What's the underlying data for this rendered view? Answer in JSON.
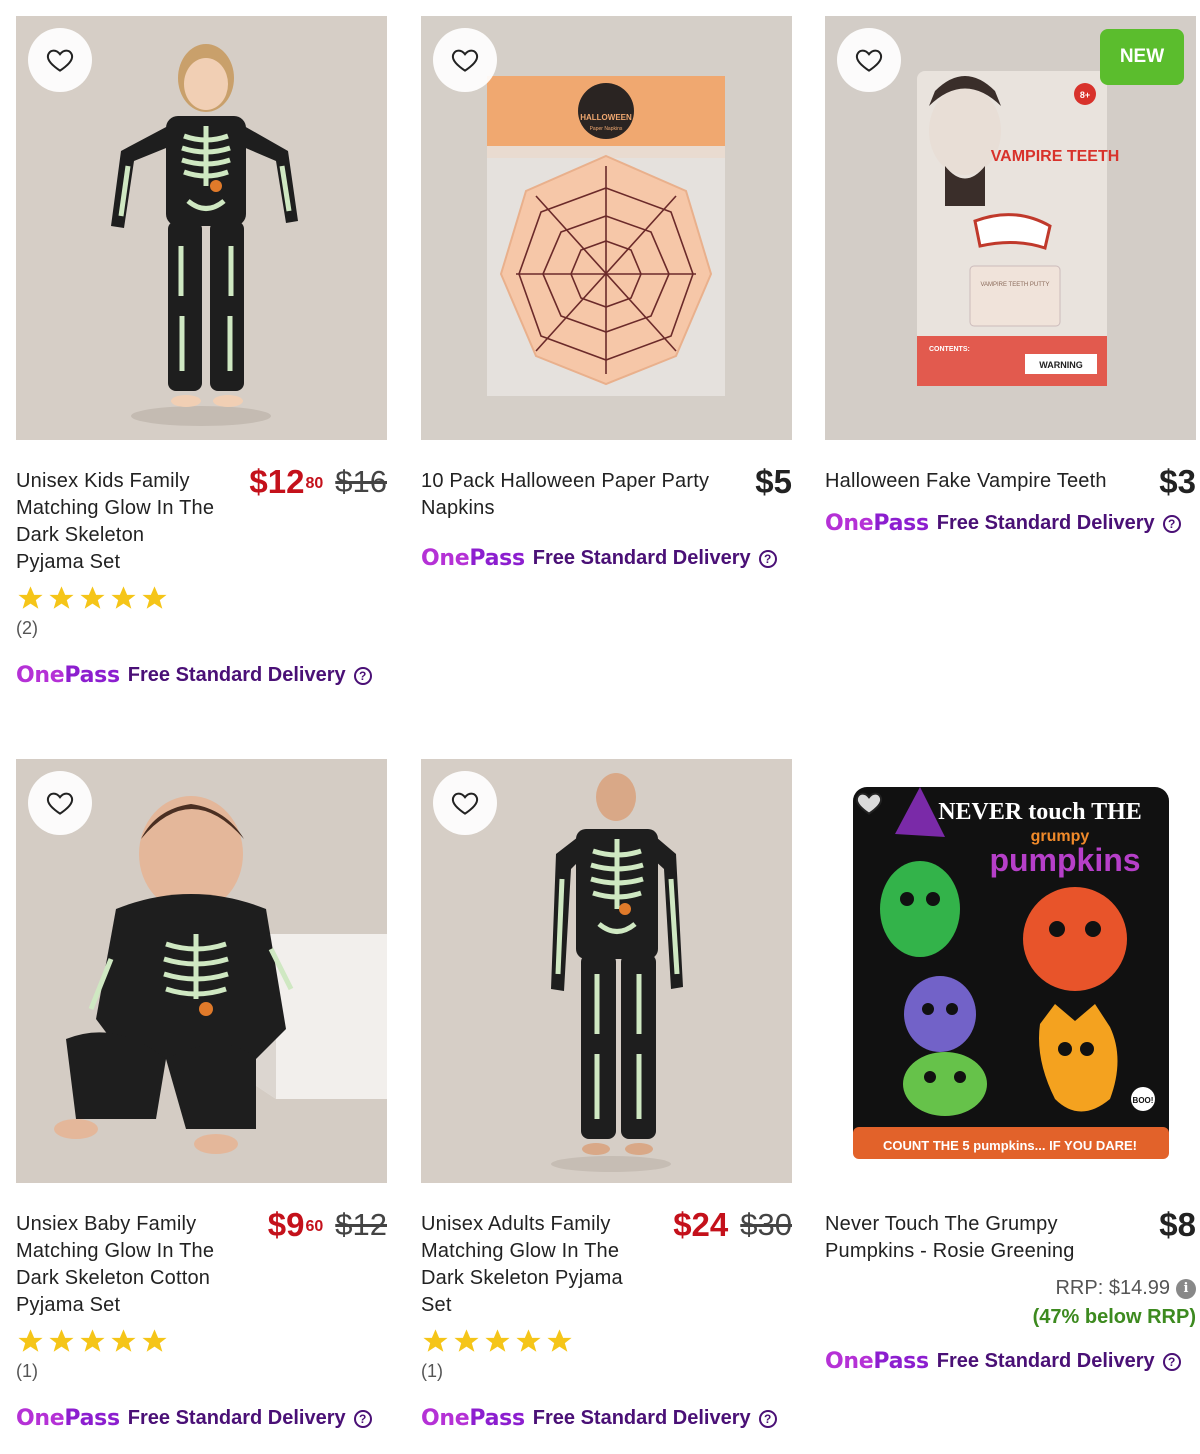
{
  "products": [
    {
      "title": "Unisex Kids Family Matching Glow In The Dark Skeleton Pyjama Set",
      "price_whole": "$12",
      "price_cents": "80",
      "was_price": "$16",
      "rating": 5,
      "review_count": "(2)",
      "image_alt": "Child wearing glow in the dark skeleton pyjamas"
    },
    {
      "title": "10 Pack Halloween Paper Party Napkins",
      "price_whole": "$5",
      "package_title": "HALLOWEEN",
      "package_sub": "Paper Napkins"
    },
    {
      "title": "Halloween Fake Vampire Teeth",
      "price_whole": "$3",
      "badge": "NEW",
      "package_title": "VAMPIRE TEETH",
      "package_age": "8+",
      "package_warning": "WARNING",
      "package_contents": "CONTENTS:",
      "package_putty": "VAMPIRE TEETH PUTTY"
    },
    {
      "title": "Unsiex Baby Family Matching Glow In The Dark Skeleton Cotton Pyjama Set",
      "price_whole": "$9",
      "price_cents": "60",
      "was_price": "$12",
      "rating": 5,
      "review_count": "(1)"
    },
    {
      "title": "Unisex Adults Family Matching Glow In The Dark Skeleton Pyjama Set",
      "price_whole": "$24",
      "was_price": "$30",
      "rating": 5,
      "review_count": "(1)"
    },
    {
      "title": "Never Touch The Grumpy Pumpkins - Rosie Greening",
      "price_whole": "$8",
      "rrp": "RRP: $14.99",
      "below_rrp": "(47% below RRP)",
      "book_top": "NEVER touch THE",
      "book_grumpy": "grumpy",
      "book_pumpkins": "pumpkins",
      "book_bottom": "COUNT THE 5 pumpkins... IF YOU DARE!",
      "book_boo": "BOO!"
    }
  ],
  "onepass": {
    "logo_one": "One",
    "logo_pass": "Pass",
    "delivery_text": "Free Standard Delivery",
    "help_symbol": "?"
  },
  "info_symbol": "i",
  "colors": {
    "sale_red": "#c4111b",
    "onepass_purple": "#8c1ecf",
    "delivery_purple": "#4a1076",
    "star_yellow": "#f5c518",
    "new_green": "#5bbd2d",
    "below_rrp_green": "#3d8a1f"
  }
}
